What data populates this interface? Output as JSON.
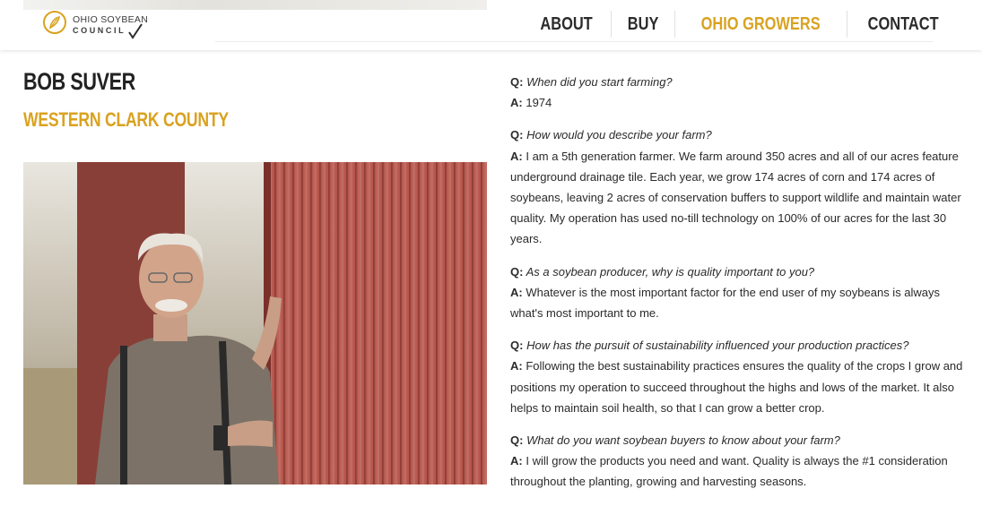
{
  "logo": {
    "line1": "OHIO SOYBEAN",
    "line2": "COUNCIL"
  },
  "nav": [
    {
      "label": "ABOUT",
      "active": false
    },
    {
      "label": "BUY",
      "active": false
    },
    {
      "label": "OHIO GROWERS",
      "active": true
    },
    {
      "label": "CONTACT",
      "active": false
    }
  ],
  "profile": {
    "name": "BOB SUVER",
    "county": "WESTERN CLARK COUNTY"
  },
  "qa": [
    {
      "q_label": "Q:",
      "q": "When did you start farming?",
      "a_label": "A:",
      "a": "1974"
    },
    {
      "q_label": "Q:",
      "q": "How would you describe your farm?",
      "a_label": "A:",
      "a": "I am a 5th generation farmer. We farm around 350 acres and all of our acres feature underground drainage tile. Each year, we grow 174 acres of corn and 174 acres of soybeans, leaving 2 acres of conservation buffers to support wildlife and maintain water quality. My operation has used no-till technology on 100% of our acres for the last 30 years."
    },
    {
      "q_label": "Q:",
      "q": "As a soybean producer, why is quality important to you?",
      "a_label": "A:",
      "a": "Whatever is the most important factor for the end user of my soybeans is always what's most important to me."
    },
    {
      "q_label": "Q:",
      "q": "How has the pursuit of sustainability influenced your production practices?",
      "a_label": "A:",
      "a": "Following the best sustainability practices ensures the quality of the crops I grow and positions my operation to succeed throughout the highs and lows of the market. It also helps to maintain soil health, so that I can grow a better crop."
    },
    {
      "q_label": "Q:",
      "q": "What do you want soybean buyers to know about your farm?",
      "a_label": "A:",
      "a": "I will grow the products you need and want. Quality is always the #1 consideration throughout the planting, growing and harvesting seasons."
    }
  ],
  "colors": {
    "accent": "#d9a21f",
    "barn": "#b5534a"
  }
}
